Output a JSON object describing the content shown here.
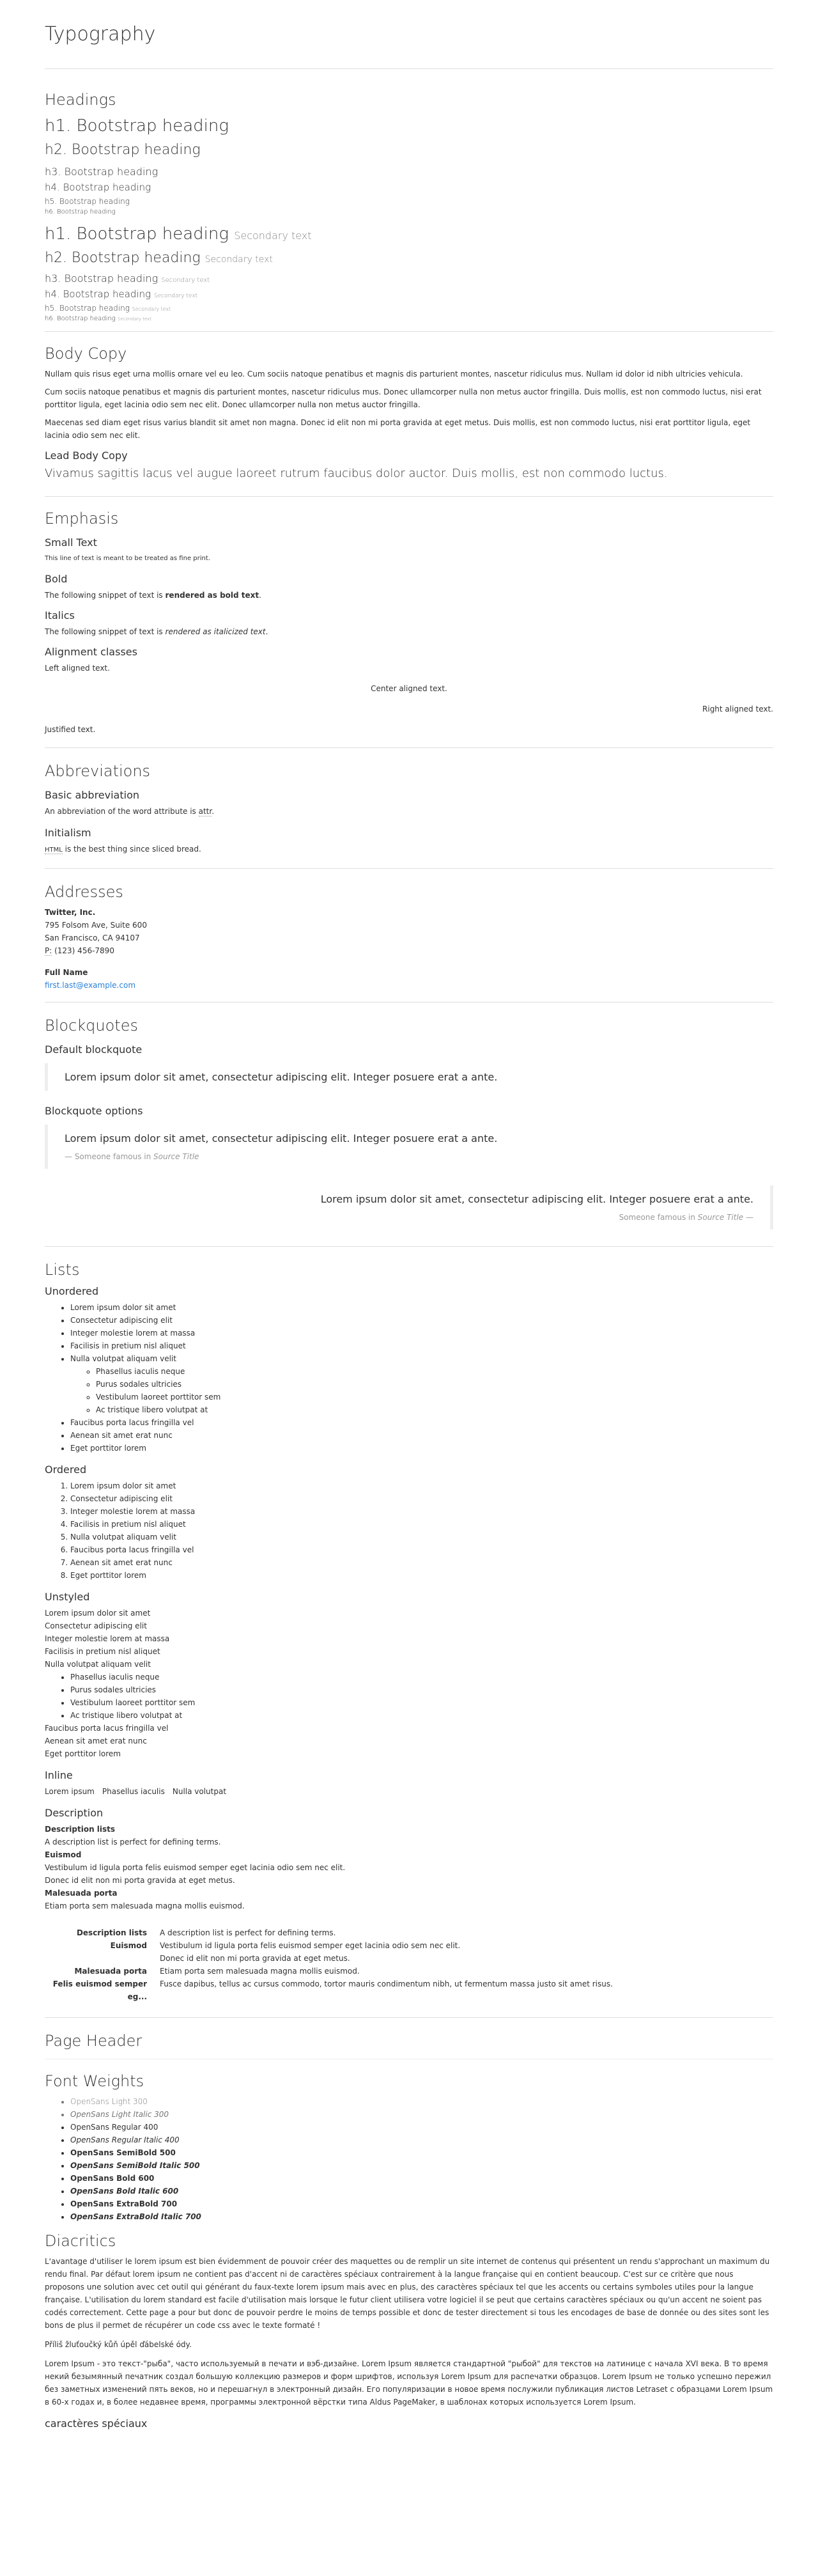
{
  "title": "Typography",
  "headings": {
    "title": "Headings",
    "h": [
      "h1. Bootstrap heading",
      "h2. Bootstrap heading",
      "h3. Bootstrap heading",
      "h4. Bootstrap heading",
      "h5. Bootstrap heading",
      "h6. Bootstrap heading"
    ],
    "secondary": "Secondary text"
  },
  "body_copy": {
    "title": "Body Copy",
    "p1": "Nullam quis risus eget urna mollis ornare vel eu leo. Cum sociis natoque penatibus et magnis dis parturient montes, nascetur ridiculus mus. Nullam id dolor id nibh ultricies vehicula.",
    "p2": "Cum sociis natoque penatibus et magnis dis parturient montes, nascetur ridiculus mus. Donec ullamcorper nulla non metus auctor fringilla. Duis mollis, est non commodo luctus, nisi erat porttitor ligula, eget lacinia odio sem nec elit. Donec ullamcorper nulla non metus auctor fringilla.",
    "p3": "Maecenas sed diam eget risus varius blandit sit amet non magna. Donec id elit non mi porta gravida at eget metus. Duis mollis, est non commodo luctus, nisi erat porttitor ligula, eget lacinia odio sem nec elit.",
    "lead_title": "Lead Body Copy",
    "lead": "Vivamus sagittis lacus vel augue laoreet rutrum faucibus dolor auctor. Duis mollis, est non commodo luctus."
  },
  "emphasis": {
    "title": "Emphasis",
    "small_title": "Small Text",
    "small_text": "This line of text is meant to be treated as fine print.",
    "bold_title": "Bold",
    "bold_pre": "The following snippet of text is ",
    "bold_word": "rendered as bold text",
    "italics_title": "Italics",
    "italics_pre": "The following snippet of text is ",
    "italics_word": "rendered as italicized text",
    "align_title": "Alignment classes",
    "left": "Left aligned text.",
    "center": "Center aligned text.",
    "right": "Right aligned text.",
    "justified": "Justified text."
  },
  "abbreviations": {
    "title": "Abbreviations",
    "basic_title": "Basic abbreviation",
    "basic_pre": "An abbreviation of the word attribute is ",
    "basic_abbr": "attr",
    "initialism_title": "Initialism",
    "initialism_abbr": "HTML",
    "initialism_post": " is the best thing since sliced bread."
  },
  "addresses": {
    "title": "Addresses",
    "company": "Twitter, Inc.",
    "line1": "795 Folsom Ave, Suite 600",
    "line2": "San Francisco, CA 94107",
    "phone_abbr": "P:",
    "phone": " (123) 456-7890",
    "name": "Full Name",
    "email": "first.last@example.com"
  },
  "blockquotes": {
    "title": "Blockquotes",
    "default_title": "Default blockquote",
    "quote": "Lorem ipsum dolor sit amet, consectetur adipiscing elit. Integer posuere erat a ante.",
    "options_title": "Blockquote options",
    "footer_pre": "— Someone famous in ",
    "footer_source": "Source Title",
    "footer_right_pre": "Someone famous in ",
    "footer_right_post": " —"
  },
  "lists": {
    "title": "Lists",
    "unordered_title": "Unordered",
    "items_a": [
      "Lorem ipsum dolor sit amet",
      "Consectetur adipiscing elit",
      "Integer molestie lorem at massa",
      "Facilisis in pretium nisl aliquet",
      "Nulla volutpat aliquam velit"
    ],
    "nested": [
      "Phasellus iaculis neque",
      "Purus sodales ultricies",
      "Vestibulum laoreet porttitor sem",
      "Ac tristique libero volutpat at"
    ],
    "items_b": [
      "Faucibus porta lacus fringilla vel",
      "Aenean sit amet erat nunc",
      "Eget porttitor lorem"
    ],
    "ordered_title": "Ordered",
    "ordered": [
      "Lorem ipsum dolor sit amet",
      "Consectetur adipiscing elit",
      "Integer molestie lorem at massa",
      "Facilisis in pretium nisl aliquet",
      "Nulla volutpat aliquam velit",
      "Faucibus porta lacus fringilla vel",
      "Aenean sit amet erat nunc",
      "Eget porttitor lorem"
    ],
    "unstyled_title": "Unstyled",
    "inline_title": "Inline",
    "inline": [
      "Lorem ipsum",
      "Phasellus iaculis",
      "Nulla volutpat"
    ],
    "description_title": "Description",
    "dl": [
      {
        "dt": "Description lists",
        "dd": [
          "A description list is perfect for defining terms."
        ]
      },
      {
        "dt": "Euismod",
        "dd": [
          "Vestibulum id ligula porta felis euismod semper eget lacinia odio sem nec elit.",
          "Donec id elit non mi porta gravida at eget metus."
        ]
      },
      {
        "dt": "Malesuada porta",
        "dd": [
          "Etiam porta sem malesuada magna mollis euismod."
        ]
      }
    ],
    "dl_h_last_dt": "Felis euismod semper eg...",
    "dl_h_last_dd": "Fusce dapibus, tellus ac cursus commodo, tortor mauris condimentum nibh, ut fermentum massa justo sit amet risus."
  },
  "page_header": {
    "title": "Page Header"
  },
  "font_weights": {
    "title": "Font Weights",
    "items": [
      "OpenSans Light 300",
      "OpenSans Light Italic 300",
      "OpenSans Regular 400",
      "OpenSans Regular Italic 400",
      "OpenSans SemiBold 500",
      "OpenSans SemiBold Italic 500",
      "OpenSans Bold 600",
      "OpenSans Bold Italic 600",
      "OpenSans ExtraBold 700",
      "OpenSans ExtraBold Italic 700"
    ]
  },
  "diacritics": {
    "title": "Diacritics",
    "fr": "L'avantage d'utiliser le lorem ipsum est bien évidemment de pouvoir créer des maquettes ou de remplir un site internet de contenus qui présentent un rendu s'approchant un maximum du rendu final. Par défaut lorem ipsum ne contient pas d'accent ni de caractères spéciaux contrairement à la langue française qui en contient beaucoup. C'est sur ce critère que nous proposons une solution avec cet outil qui générant du faux-texte lorem ipsum mais avec en plus, des caractères spéciaux tel que les accents ou certains symboles utiles pour la langue française. L'utilisation du lorem standard est facile d'utilisation mais lorsque le futur client utilisera votre logiciel il se peut que certains caractères spéciaux ou qu'un accent ne soient pas codés correctement. Cette page a pour but donc de pouvoir perdre le moins de temps possible et donc de tester directement si tous les encodages de base de donnée ou des sites sont les bons de plus il permet de récupérer un code css avec le texte formaté !",
    "cz": "Příliš žluťoučký kůň úpěl ďábelské ódy.",
    "ru": "Lorem Ipsum - это текст-\"рыба\", часто используемый в печати и вэб-дизайне. Lorem Ipsum является стандартной \"рыбой\" для текстов на латинице с начала XVI века. В то время некий безымянный печатник создал большую коллекцию размеров и форм шрифтов, используя Lorem Ipsum для распечатки образцов. Lorem Ipsum не только успешно пережил без заметных изменений пять веков, но и перешагнул в электронный дизайн. Его популяризации в новое время послужили публикация листов Letraset с образцами Lorem Ipsum в 60-х годах и, в более недавнее время, программы электронной вёрстки типа Aldus PageMaker, в шаблонах которых используется Lorem Ipsum.",
    "special": "caractères spéciaux"
  }
}
